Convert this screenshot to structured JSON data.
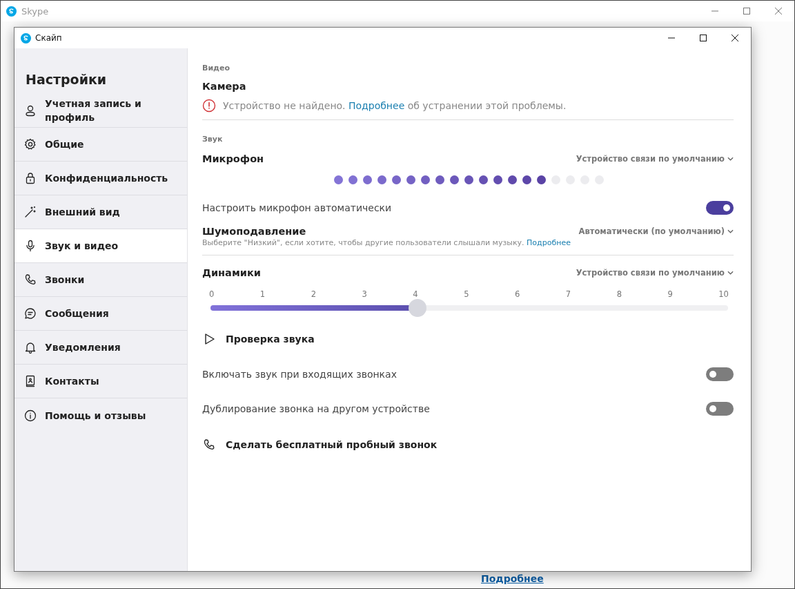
{
  "background_window": {
    "title": "Skype",
    "link": "Подробнее"
  },
  "window": {
    "title": "Скайп"
  },
  "sidebar": {
    "title": "Настройки",
    "items": [
      {
        "label": "Учетная запись и профиль",
        "selected": false
      },
      {
        "label": "Общие",
        "selected": false
      },
      {
        "label": "Конфиденциальность",
        "selected": false
      },
      {
        "label": "Внешний вид",
        "selected": false
      },
      {
        "label": "Звук и видео",
        "selected": true
      },
      {
        "label": "Звонки",
        "selected": false
      },
      {
        "label": "Сообщения",
        "selected": false
      },
      {
        "label": "Уведомления",
        "selected": false
      },
      {
        "label": "Контакты",
        "selected": false
      },
      {
        "label": "Помощь и отзывы",
        "selected": false
      }
    ]
  },
  "video": {
    "section": "Видео",
    "camera_title": "Камера",
    "error": "Устройство не найдено. ",
    "error_link": "Подробнее",
    "error_rest": " об устранении этой проблемы."
  },
  "audio": {
    "section": "Звук",
    "microphone": {
      "title": "Микрофон",
      "device": "Устройство связи по умолчанию",
      "level": 0.79
    },
    "auto_adjust": {
      "label": "Настроить микрофон автоматически",
      "on": true
    },
    "noise": {
      "title": "Шумоподавление",
      "value": "Автоматически (по умолчанию)",
      "hint": "Выберите \"Низкий\", если хотите, чтобы другие пользователи слышали музыку. ",
      "hint_link": "Подробнее"
    },
    "speakers": {
      "title": "Динамики",
      "device": "Устройство связи по умолчанию",
      "ticks": [
        "0",
        "1",
        "2",
        "3",
        "4",
        "5",
        "6",
        "7",
        "8",
        "9",
        "10"
      ],
      "level": 0.4
    },
    "test_sound": "Проверка звука",
    "toggles": [
      {
        "label": "Включать звук при входящих звонках",
        "on": false
      },
      {
        "label": "Дублирование звонка на другом устройстве",
        "on": false
      }
    ],
    "test_call": "Сделать бесплатный пробный звонок"
  }
}
